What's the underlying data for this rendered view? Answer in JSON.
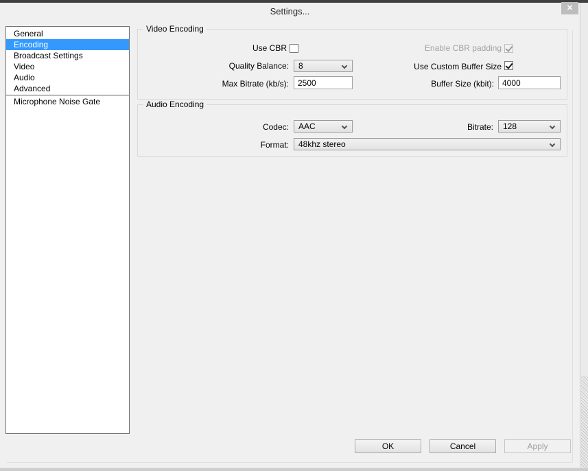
{
  "window": {
    "title": "Settings...",
    "close_glyph": "✕"
  },
  "sidebar": {
    "items": [
      "General",
      "Encoding",
      "Broadcast Settings",
      "Video",
      "Audio",
      "Advanced",
      "Microphone Noise Gate"
    ],
    "selected": "Encoding"
  },
  "video_encoding": {
    "title": "Video Encoding",
    "use_cbr_label": "Use CBR",
    "use_cbr_checked": false,
    "enable_cbr_padding_label": "Enable CBR padding",
    "enable_cbr_padding_checked": true,
    "enable_cbr_padding_disabled": true,
    "quality_balance_label": "Quality Balance:",
    "quality_balance_value": "8",
    "use_custom_buffer_label": "Use Custom Buffer Size",
    "use_custom_buffer_checked": true,
    "max_bitrate_label": "Max Bitrate (kb/s):",
    "max_bitrate_value": "2500",
    "buffer_size_label": "Buffer Size (kbit):",
    "buffer_size_value": "4000"
  },
  "audio_encoding": {
    "title": "Audio Encoding",
    "codec_label": "Codec:",
    "codec_value": "AAC",
    "bitrate_label": "Bitrate:",
    "bitrate_value": "128",
    "format_label": "Format:",
    "format_value": "48khz stereo"
  },
  "footer": {
    "ok_label": "OK",
    "cancel_label": "Cancel",
    "apply_label": "Apply",
    "apply_disabled": true
  },
  "colors": {
    "selection": "#3399ff",
    "dialog_bg": "#f0f0f0",
    "close_button": "#bdbdbd",
    "top_edge": "#3f3f3f"
  }
}
